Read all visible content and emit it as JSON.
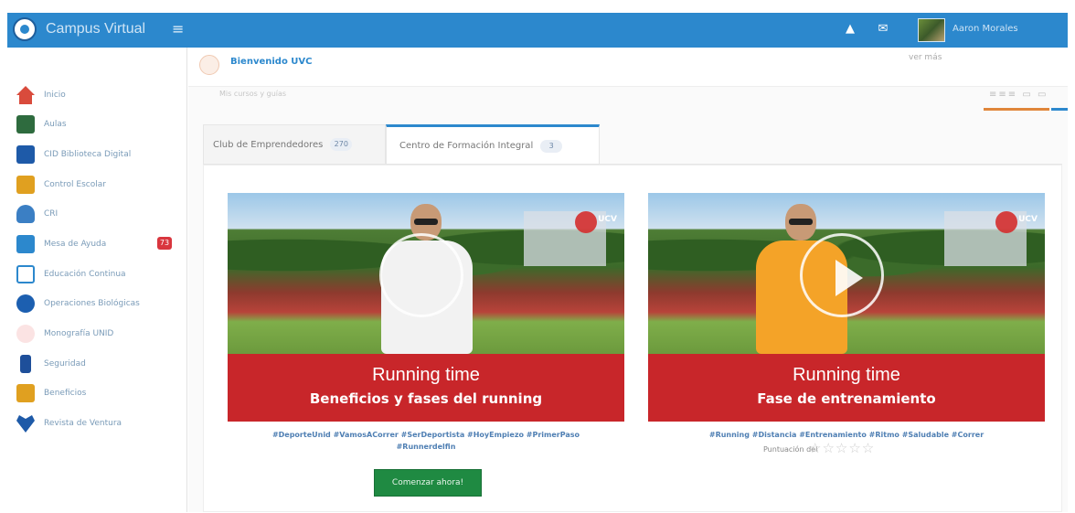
{
  "topbar": {
    "brand": "Campus Virtual",
    "hamburger_icon": "≡",
    "notification_icon": "▲",
    "mail_icon": "✉",
    "user_name": "Aaron Morales"
  },
  "sidebar": {
    "items": [
      {
        "label": "Inicio",
        "icon": "home-icon",
        "color": "#d94b3c"
      },
      {
        "label": "Aulas",
        "icon": "classroom-icon",
        "color": "#2e6b3e"
      },
      {
        "label": "CID Biblioteca Digital",
        "icon": "book-icon",
        "color": "#1e5aa8"
      },
      {
        "label": "Control Escolar",
        "icon": "folder-icon",
        "color": "#e0a020"
      },
      {
        "label": "CRI",
        "icon": "people-icon",
        "color": "#3b7fc4"
      },
      {
        "label": "Mesa de Ayuda",
        "icon": "help-icon",
        "color": "#2c88cd",
        "badge": "73"
      },
      {
        "label": "Educación Continua",
        "icon": "education-icon",
        "color": "#2c88cd"
      },
      {
        "label": "Operaciones Biológicas",
        "icon": "globe-icon",
        "color": "#1c5fb0"
      },
      {
        "label": "Monografía UNID",
        "icon": "document-icon",
        "color": "#f2a6a6"
      },
      {
        "label": "Seguridad",
        "icon": "lock-icon",
        "color": "#1e4f9a"
      },
      {
        "label": "Beneficios",
        "icon": "gift-icon",
        "color": "#e0a020"
      },
      {
        "label": "Revista de Ventura",
        "icon": "heart-icon",
        "color": "#1e5aa8"
      }
    ]
  },
  "header": {
    "breadcrumb": "Bienvenido UVC",
    "top_right_hint": "ver más",
    "subtext": "Mis cursos y guías",
    "view_toggle": "≡≡≡  ▭  ▭"
  },
  "tabs": [
    {
      "label": "Club de Emprendedores",
      "count": "270"
    },
    {
      "label": "Centro de Formación Integral",
      "count": "3"
    }
  ],
  "cards": [
    {
      "ucv": "UCV",
      "title": "Running time",
      "subtitle": "Beneficios y fases del running",
      "tags": "#DeporteUnid #VamosACorrer #SerDeportista #HoyEmpiezo #PrimerPaso #Runnerdelfin",
      "cta": "Comenzar ahora!",
      "shirt_color": "#f2f2f2"
    },
    {
      "ucv": "UCV",
      "title": "Running time",
      "subtitle": "Fase de entrenamiento",
      "tags": "#Running #Distancia #Entrenamiento #Ritmo #Saludable #Correr",
      "rating_label": "Puntuación del",
      "stars": "☆☆☆☆☆",
      "shirt_color": "#f4a328"
    }
  ],
  "colors": {
    "topbar": "#2c88cd",
    "banner": "#c8262a",
    "cta": "#1f8a42",
    "accent_orange": "#e0863a"
  }
}
